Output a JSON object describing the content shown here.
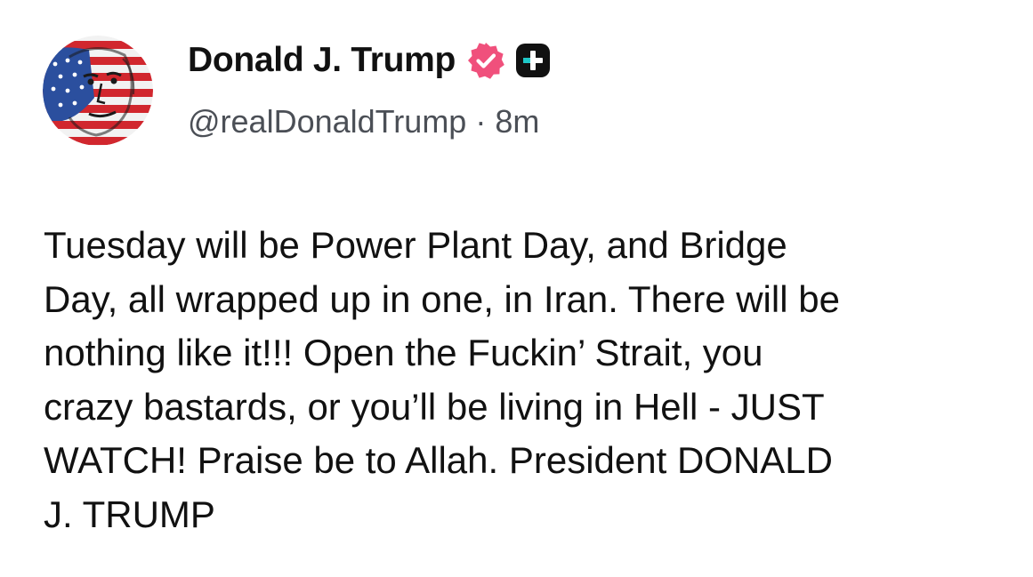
{
  "post": {
    "author": {
      "display_name": "Donald J. Trump",
      "handle": "@realDonaldTrump",
      "verified_icon": "verified-badge-icon",
      "plus_icon": "plus-badge-icon",
      "avatar": "avatar-flag-portrait"
    },
    "separator": "·",
    "timestamp": "8m",
    "body": "Tuesday will be Power Plant Day, and Bridge\nDay, all wrapped up in one, in Iran. There will be\nnothing like it!!! Open the Fuckin’ Strait, you\ncrazy bastards, or you’ll be living in Hell - JUST\nWATCH! Praise be to Allah. President DONALD\nJ. TRUMP"
  },
  "colors": {
    "verified_badge": "#f0507c",
    "plus_badge": "#111111",
    "plus_accent": "#1ec8c8",
    "text_primary": "#111111",
    "text_secondary": "#4b4f56",
    "background": "#ffffff"
  }
}
